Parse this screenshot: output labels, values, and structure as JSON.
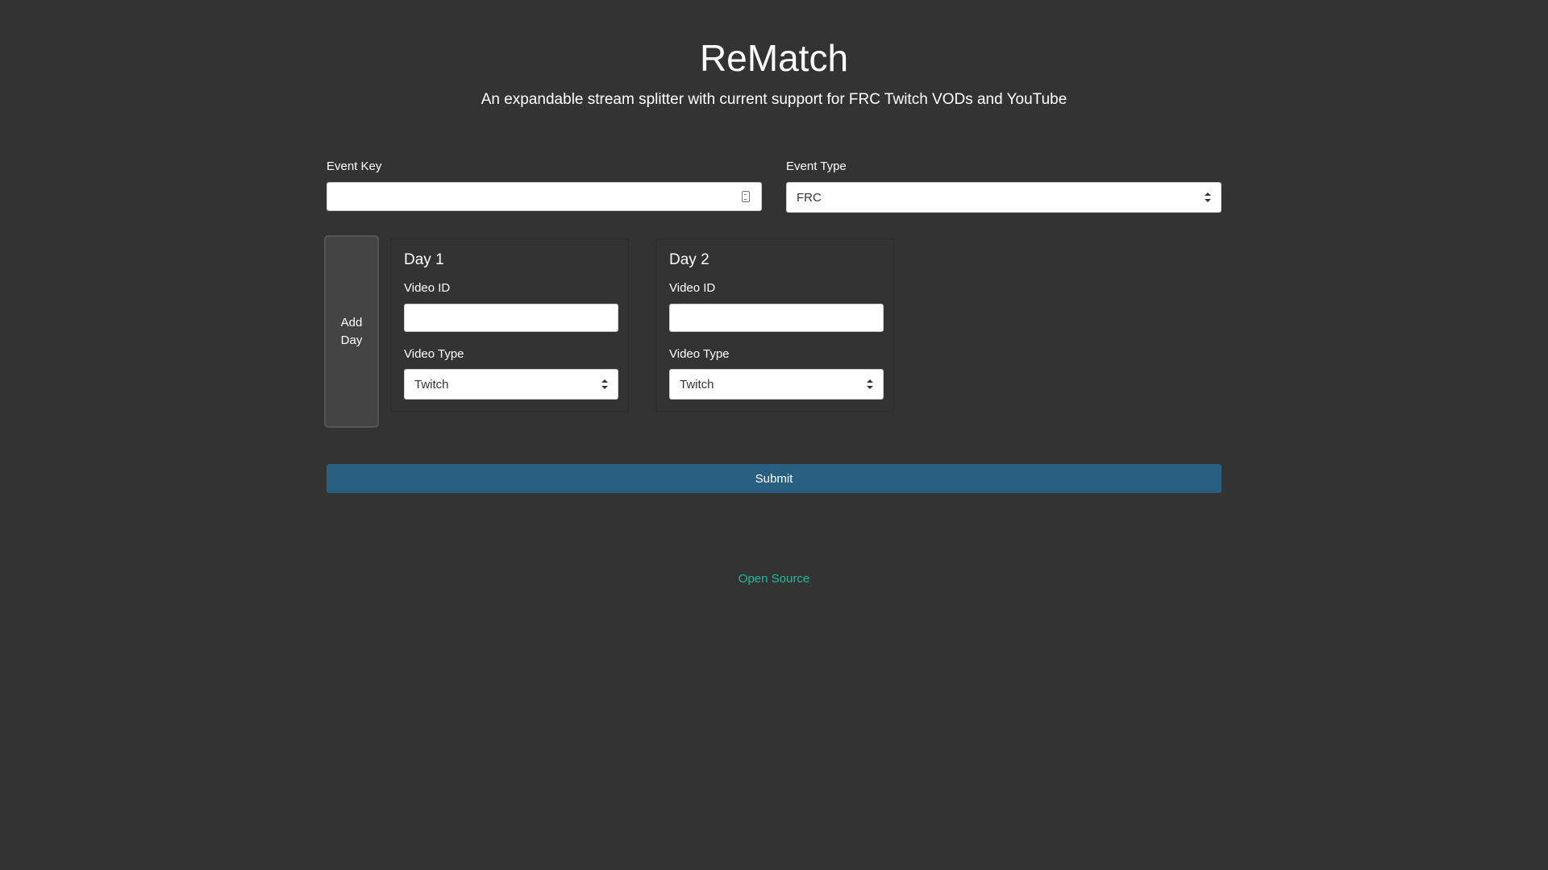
{
  "header": {
    "title": "ReMatch",
    "subtitle": "An expandable stream splitter with current support for FRC Twitch VODs and YouTube"
  },
  "event_key": {
    "label": "Event Key",
    "value": ""
  },
  "event_type": {
    "label": "Event Type",
    "selected": "FRC"
  },
  "add_day": {
    "label_line1": "Add",
    "label_line2": "Day"
  },
  "days": [
    {
      "title": "Day 1",
      "video_id_label": "Video ID",
      "video_id_value": "",
      "video_type_label": "Video Type",
      "video_type_selected": "Twitch"
    },
    {
      "title": "Day 2",
      "video_id_label": "Video ID",
      "video_id_value": "",
      "video_type_label": "Video Type",
      "video_type_selected": "Twitch"
    }
  ],
  "submit": {
    "label": "Submit"
  },
  "footer": {
    "link": "Open Source"
  },
  "colors": {
    "background": "#333333",
    "primary": "#285e7f",
    "link": "#18bc9c"
  }
}
